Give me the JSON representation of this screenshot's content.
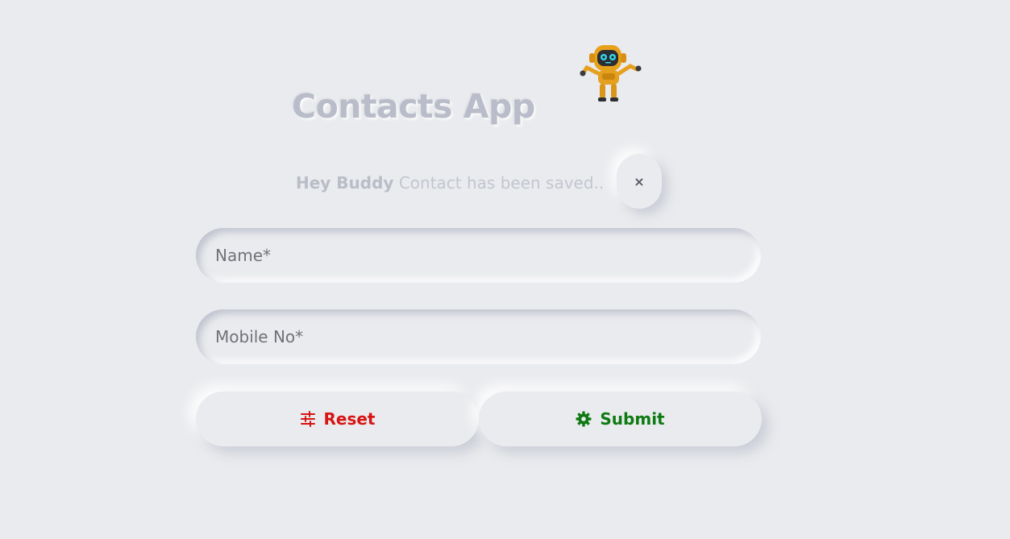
{
  "app": {
    "title": "Contacts App"
  },
  "alert": {
    "strong_text": "Hey Buddy",
    "message": "Contact has been saved..",
    "close_label": "×"
  },
  "form": {
    "name_placeholder": "Name*",
    "name_value": "",
    "mobile_placeholder": "Mobile No*",
    "mobile_value": ""
  },
  "actions": {
    "reset_label": "Reset",
    "reset_icon": "sliders-icon",
    "reset_color": "#d81313",
    "submit_label": "Submit",
    "submit_icon": "gear-icon",
    "submit_color": "#0e7a12"
  },
  "colors": {
    "background": "#eaebee",
    "title": "#b9bdc9"
  }
}
